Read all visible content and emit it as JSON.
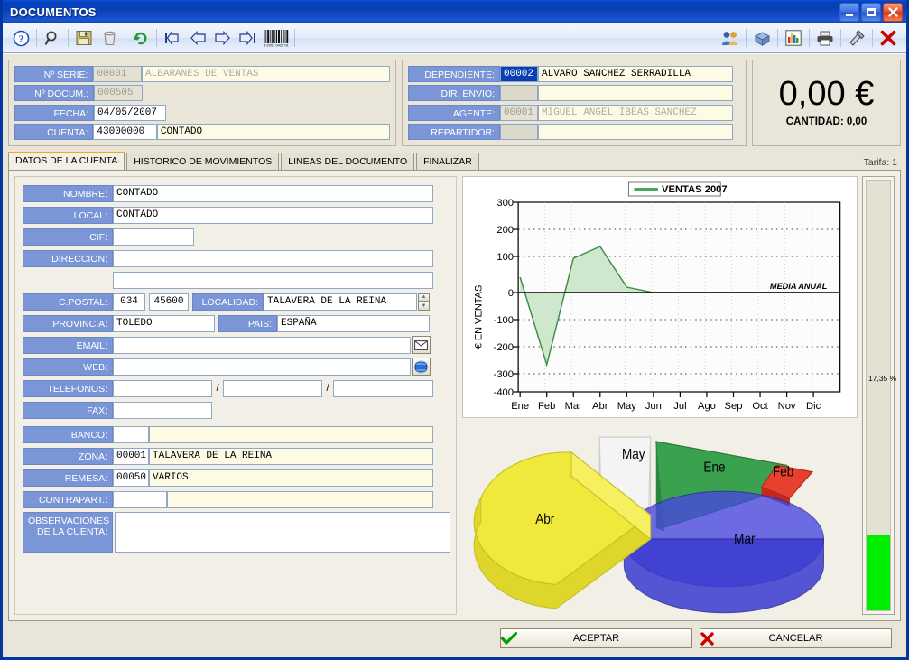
{
  "window": {
    "title": "DOCUMENTOS",
    "minimize_label": "_",
    "maximize_label": "□",
    "close_label": "✕"
  },
  "toolbar": {
    "items": [
      {
        "name": "help-icon",
        "glyph": "?"
      },
      {
        "name": "search-icon",
        "glyph": "⌕"
      },
      {
        "name": "save-icon",
        "glyph": "ὋE"
      },
      {
        "name": "delete-icon",
        "glyph": "Ὕ1"
      },
      {
        "name": "refresh-icon",
        "glyph": "↻"
      },
      {
        "name": "first-record-icon",
        "glyph": "|⇐"
      },
      {
        "name": "previous-record-icon",
        "glyph": "⇐"
      },
      {
        "name": "next-record-icon",
        "glyph": "⇒"
      },
      {
        "name": "last-record-icon",
        "glyph": "⇒|"
      },
      {
        "name": "barcode-icon",
        "glyph": "|||"
      }
    ],
    "right_items": [
      {
        "name": "users-icon",
        "glyph": "὆5"
      },
      {
        "name": "package-icon",
        "glyph": "὎6"
      },
      {
        "name": "chart-icon",
        "glyph": "ὌA"
      },
      {
        "name": "print-icon",
        "glyph": "὚8"
      },
      {
        "name": "tools-icon",
        "glyph": "⚒"
      },
      {
        "name": "close-icon",
        "glyph": "✖"
      }
    ]
  },
  "header": {
    "left_fields": [
      {
        "label": "Nº SERIE:",
        "code": "00001",
        "desc": "ALBARANES DE VENTAS",
        "code_state": "disabled",
        "desc_state": "disabled"
      },
      {
        "label": "Nº DOCUM.:",
        "code": "000505",
        "desc": "",
        "code_state": "disabled",
        "desc_state": "none"
      },
      {
        "label": "FECHA:",
        "code": "04/05/2007",
        "desc": "",
        "code_state": "normal",
        "desc_state": "none"
      },
      {
        "label": "CUENTA:",
        "code": "43000000",
        "desc": "CONTADO",
        "code_state": "normal",
        "desc_state": "cream"
      }
    ],
    "right_fields": [
      {
        "label": "DEPENDIENTE:",
        "code": "00002",
        "desc": "ALVARO SANCHEZ SERRADILLA",
        "code_state": "selected",
        "desc_state": "cream"
      },
      {
        "label": "DIR. ENVIO:",
        "code": "",
        "desc": "",
        "code_state": "grey",
        "desc_state": "cream"
      },
      {
        "label": "AGENTE:",
        "code": "00001",
        "desc": "MIGUEL ANGEL IBEAS SANCHEZ",
        "code_state": "disabled",
        "desc_state": "disabled2"
      },
      {
        "label": "REPARTIDOR:",
        "code": "",
        "desc": "",
        "code_state": "grey",
        "desc_state": "cream"
      }
    ],
    "total": {
      "amount": "0,00 €",
      "quantity_label": "CANTIDAD: 0,00"
    }
  },
  "tabs": {
    "items": [
      {
        "label": "DATOS DE LA CUENTA",
        "active": true
      },
      {
        "label": "HISTORICO DE MOVIMIENTOS",
        "active": false
      },
      {
        "label": "LINEAS DEL DOCUMENTO",
        "active": false
      },
      {
        "label": "FINALIZAR",
        "active": false
      }
    ],
    "tarifa": "Tarifa: 1"
  },
  "form": {
    "nombre": {
      "label": "NOMBRE:",
      "value": "CONTADO"
    },
    "local": {
      "label": "LOCAL:",
      "value": "CONTADO"
    },
    "cif": {
      "label": "CIF:",
      "value": ""
    },
    "direccion": {
      "label": "DIRECCION:",
      "value": "",
      "value2": ""
    },
    "cpostal": {
      "label": "C.POSTAL:",
      "value1": "034",
      "value2": "45600"
    },
    "localidad": {
      "label": "LOCALIDAD:",
      "value": "TALAVERA DE LA REINA"
    },
    "provincia": {
      "label": "PROVINCIA:",
      "value": "TOLEDO"
    },
    "pais": {
      "label": "PAIS:",
      "value": "ESPAÑA"
    },
    "email": {
      "label": "EMAIL:",
      "value": "",
      "icon": "envelope-icon"
    },
    "web": {
      "label": "WEB:",
      "value": "",
      "icon": "globe-icon"
    },
    "telefonos": {
      "label": "TELEFONOS:",
      "value1": "",
      "value2": "",
      "value3": "",
      "sep": "/"
    },
    "fax": {
      "label": "FAX:",
      "value": ""
    },
    "banco": {
      "label": "BANCO:",
      "code": "",
      "desc": ""
    },
    "zona": {
      "label": "ZONA:",
      "code": "00001",
      "desc": "TALAVERA DE LA REINA"
    },
    "remesa": {
      "label": "REMESA:",
      "code": "00050",
      "desc": "VARIOS"
    },
    "contrapart": {
      "label": "CONTRAPART.:",
      "code": "",
      "desc": ""
    },
    "observaciones": {
      "label": "OBSERVACIONES\nDE LA CUENTA:",
      "label_l1": "OBSERVACIONES",
      "label_l2": "DE LA CUENTA:",
      "value": ""
    }
  },
  "gauge": {
    "percent_label": "17,35 %",
    "percent_value": 17.35,
    "fill_color": "#00ee00"
  },
  "buttons": {
    "accept": {
      "label": "ACEPTAR",
      "glyph": "✔",
      "color": "#00a000"
    },
    "cancel": {
      "label": "CANCELAR",
      "glyph": "✖",
      "color": "#cc0000"
    }
  },
  "chart_data": [
    {
      "type": "area",
      "name": "ventas-line-chart",
      "title": "",
      "legend": [
        "VENTAS 2007"
      ],
      "legend_position": "top-center",
      "legend_color": "#2e8b3c",
      "xlabel": "",
      "ylabel": "€ EN VENTAS",
      "categories": [
        "Ene",
        "Feb",
        "Mar",
        "Abr",
        "May",
        "Jun",
        "Jul",
        "Ago",
        "Sep",
        "Oct",
        "Nov",
        "Dic"
      ],
      "values": [
        55,
        -268,
        125,
        170,
        20,
        0,
        0,
        0,
        0,
        0,
        0,
        0
      ],
      "ylim": [
        -400,
        300
      ],
      "yticks": [
        -400,
        -300,
        -200,
        -100,
        0,
        100,
        200,
        300
      ],
      "grid": true,
      "annotations": [
        {
          "text": "MEDIA ANUAL",
          "y": 0
        }
      ],
      "line_color": "#2e8b3c",
      "fill_color": "#cfe7cd"
    },
    {
      "type": "pie",
      "name": "ventas-pie-chart",
      "title": "",
      "categories": [
        "Ene",
        "Feb",
        "Mar",
        "Abr",
        "May"
      ],
      "values": [
        17,
        3,
        33,
        40,
        7
      ],
      "colors": [
        "#3aa14f",
        "#e8402e",
        "#4040e8",
        "#f0e020",
        "#f2f2f2"
      ],
      "exploded": [
        "Abr"
      ],
      "legend_position": "none"
    }
  ]
}
